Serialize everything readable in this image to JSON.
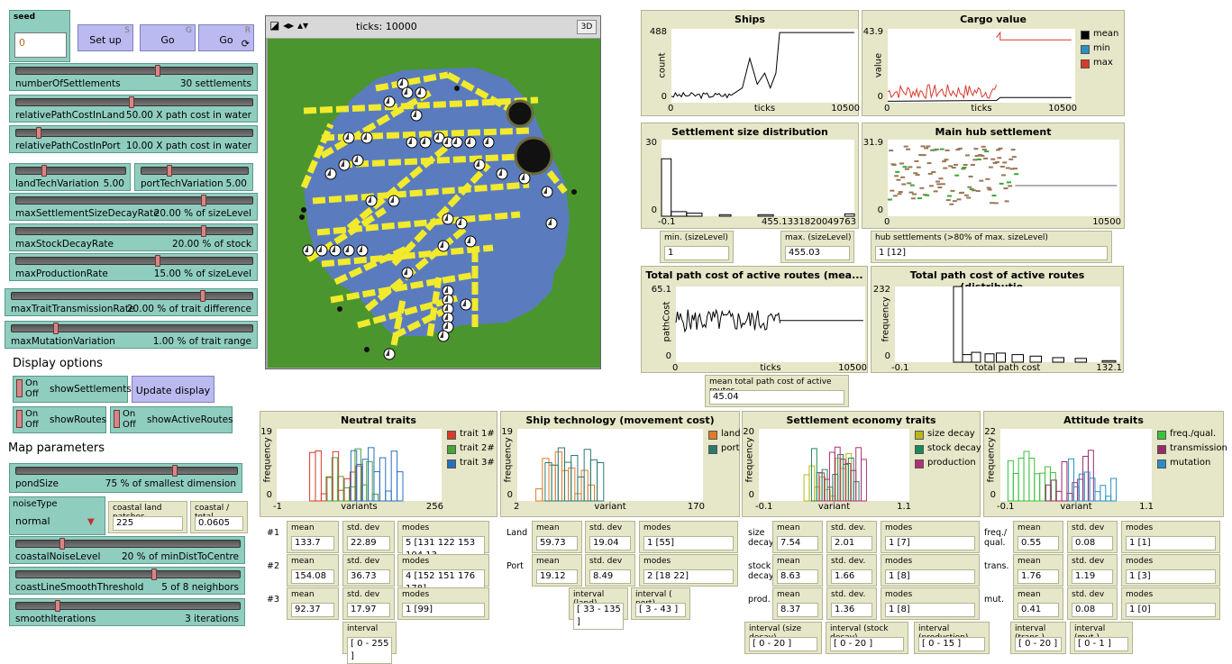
{
  "seed": {
    "label": "seed",
    "value": "0"
  },
  "buttons": {
    "setup": "Set up",
    "setup_key": "S",
    "go": "Go",
    "go_key": "G",
    "go_forever": "Go",
    "go_forever_key": "R",
    "update": "Update display"
  },
  "sliders": [
    {
      "name": "numberOfSettlements",
      "value": "30 settlements",
      "frac": 0.6
    },
    {
      "name": "relativePathCostInLand",
      "value": "50.00 X path cost in water",
      "frac": 0.49
    },
    {
      "name": "relativePathCostInPort",
      "value": "10.00 X path cost in water",
      "frac": 0.09
    },
    {
      "name": "maxSettlementSizeDecayRate",
      "value": "20.00 % of sizeLevel",
      "frac": 0.8
    },
    {
      "name": "maxStockDecayRate",
      "value": "20.00 % of stock",
      "frac": 0.8
    },
    {
      "name": "maxProductionRate",
      "value": "15.00 % of sizeLevel",
      "frac": 0.6
    },
    {
      "name": "maxTraitTransmissionRate",
      "value": "20.00 % of trait difference",
      "frac": 0.8
    },
    {
      "name": "maxMutationVariation",
      "value": "1.00 % of trait range",
      "frac": 0.18
    },
    {
      "name": "pondSize",
      "value": "75 % of smallest dimension",
      "frac": 0.72
    },
    {
      "name": "coastalNoiseLevel",
      "value": "20 % of minDistToCentre",
      "frac": 0.2
    },
    {
      "name": "coastLineSmoothThreshold",
      "value": "5 of 8 neighbors",
      "frac": 0.62
    },
    {
      "name": "smoothIterations",
      "value": "3 iterations",
      "frac": 0.18
    }
  ],
  "small_sliders": [
    {
      "name": "landTechVariation",
      "value": "5.00",
      "frac": 0.25
    },
    {
      "name": "portTechVariation",
      "value": "5.00",
      "frac": 0.25
    }
  ],
  "headings": {
    "display": "Display options",
    "map": "Map parameters"
  },
  "switches": {
    "on": "On",
    "off": "Off",
    "showSettlements": "showSettlements",
    "showRoutes": "showRoutes",
    "showActiveRoutes": "showActiveRoutes"
  },
  "chooser": {
    "label": "noiseType",
    "value": "normal"
  },
  "coastal": {
    "land_label": "coastal land patches",
    "land_value": "225",
    "ratio_label": "coastal / total",
    "ratio_value": "0.0605"
  },
  "view": {
    "ticks": "ticks: 10000",
    "btn3d": "3D"
  },
  "plots": {
    "ships": {
      "title": "Ships",
      "ymax": "488",
      "ymin": "0",
      "xmin": "0",
      "xmax": "10500",
      "xlabel": "ticks",
      "ylabel": "count"
    },
    "cargo": {
      "title": "Cargo value",
      "ymax": "43.9",
      "ymin": "0",
      "xmin": "0",
      "xmax": "10500",
      "xlabel": "ticks",
      "ylabel": "value",
      "legend": [
        "mean",
        "min",
        "max"
      ]
    },
    "sizedist": {
      "title": "Settlement size distribution",
      "ymax": "30",
      "ymin": "0",
      "xmin": "-0.1",
      "xmax": "455.1331820049763"
    },
    "hub": {
      "title": "Main hub settlement",
      "ymax": "31.9",
      "ymin": "0",
      "xmin": "0",
      "xmax": "10500"
    },
    "pathmean": {
      "title": "Total path cost of active routes (mea...",
      "ymax": "65.1",
      "ymin": "0",
      "xmin": "0",
      "xmax": "10500",
      "xlabel": "ticks",
      "ylabel": "pathCost"
    },
    "pathdist": {
      "title": "Total path cost of active routes (distributio...",
      "ymax": "232",
      "ymin": "0",
      "xmin": "-0.1",
      "xmax": "132.1",
      "xlabel": "total path cost",
      "ylabel": "frequency"
    },
    "neutral": {
      "title": "Neutral traits",
      "ymax": "19",
      "ymin": "0",
      "xmin": "-1",
      "xmax": "256",
      "xlabel": "variants",
      "ylabel": "frequency",
      "legend": [
        "trait 1#",
        "trait 2#",
        "trait 3#"
      ]
    },
    "shiptech": {
      "title": "Ship technology (movement cost)",
      "ymax": "19",
      "ymin": "0",
      "xmin": "2",
      "xmax": "170",
      "xlabel": "variant",
      "ylabel": "frequency",
      "legend": [
        "land",
        "port"
      ]
    },
    "economy": {
      "title": "Settlement economy traits",
      "ymax": "20",
      "ymin": "0",
      "xmin": "-0.1",
      "xmax": "1.1",
      "xlabel": "variant",
      "ylabel": "frequency",
      "legend": [
        "size decay",
        "stock decay",
        "production"
      ]
    },
    "attitude": {
      "title": "Attitude traits",
      "ymax": "22",
      "ymin": "0",
      "xmin": "-0.1",
      "xmax": "1.1",
      "xlabel": "variant",
      "ylabel": "frequency",
      "legend": [
        "freq./qual.",
        "transmission",
        "mutation"
      ]
    }
  },
  "monitors": {
    "size_min": {
      "label": "min. (sizeLevel)",
      "value": "1"
    },
    "size_max": {
      "label": "max. (sizeLevel)",
      "value": "455.03"
    },
    "hub": {
      "label": "hub settlements (>80% of max. sizeLevel)",
      "value": "1 [12]"
    },
    "pathmean": {
      "label": "mean total path cost of active routes",
      "value": "45.04"
    },
    "neutral_rows": [
      {
        "row": "#1",
        "mean": "133.7",
        "sd": "22.89",
        "modes": "5 [131 122 153 104 13"
      },
      {
        "row": "#2",
        "mean": "154.08",
        "sd": "36.73",
        "modes": "4 [152 151 176 178]"
      },
      {
        "row": "#3",
        "mean": "92.37",
        "sd": "17.97",
        "modes": "1 [99]"
      }
    ],
    "neutral_interval": {
      "label": "interval",
      "value": "[ 0 - 255 ]"
    },
    "ship_rows": [
      {
        "row": "Land",
        "mean": "59.73",
        "sd": "19.04",
        "modes": "1 [55]"
      },
      {
        "row": "Port",
        "mean": "19.12",
        "sd": "8.49",
        "modes": "2 [18 22]"
      }
    ],
    "ship_intervals": [
      {
        "label": "interval (land)",
        "value": "[ 33 - 135 ]"
      },
      {
        "label": "interval ( port)",
        "value": "[ 3 - 43 ]"
      }
    ],
    "econ_rows": [
      {
        "row": "size decay",
        "mean": "7.54",
        "sd": "2.01",
        "modes": "1 [7]"
      },
      {
        "row": "stock decay",
        "mean": "8.63",
        "sd": "1.66",
        "modes": "1 [8]"
      },
      {
        "row": "prod.",
        "mean": "8.37",
        "sd": "1.36",
        "modes": "1 [8]"
      }
    ],
    "econ_intervals": [
      {
        "label": "interval (size decay)",
        "value": "[ 0 - 20 ]"
      },
      {
        "label": "interval (stock decay)",
        "value": "[ 0 - 20 ]"
      },
      {
        "label": "interval (production)",
        "value": "[ 0 - 15 ]"
      }
    ],
    "att_rows": [
      {
        "row": "freq./ qual.",
        "mean": "0.55",
        "sd": "0.08",
        "modes": "1 [1]"
      },
      {
        "row": "trans.",
        "mean": "1.76",
        "sd": "1.19",
        "modes": "1 [3]"
      },
      {
        "row": "mut.",
        "mean": "0.41",
        "sd": "0.08",
        "modes": "1 [0]"
      }
    ],
    "att_intervals": [
      {
        "label": "interval (trans.)",
        "value": "[ 0 - 20 ]"
      },
      {
        "label": "interval (mut.)",
        "value": "[ 0 - 1 ]"
      }
    ],
    "labels": {
      "mean": "mean",
      "sd": "std. dev",
      "sd2": "std. dev.",
      "modes": "modes"
    }
  },
  "colors": {
    "land": "#4b952f",
    "water": "#5a7cbe",
    "route": "#f2ea2c",
    "widget": "#8fcdbf",
    "monitor": "#e6e6c8",
    "button": "#babaf0"
  }
}
